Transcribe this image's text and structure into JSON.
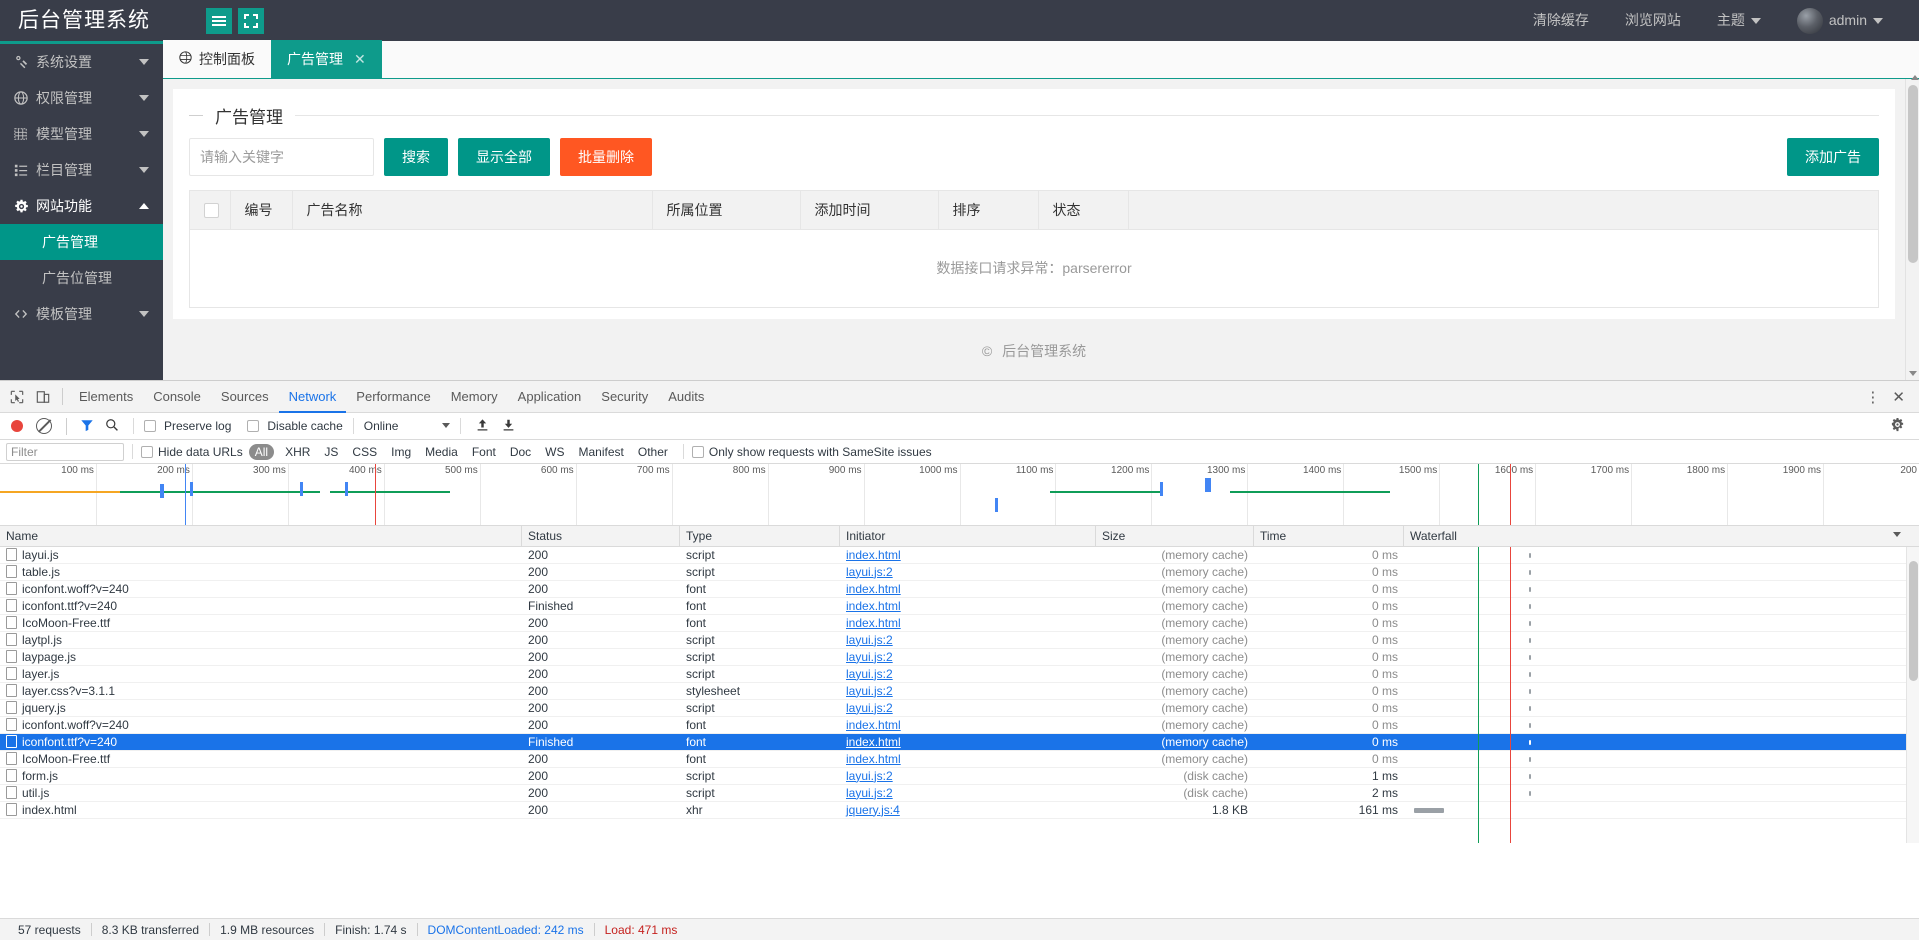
{
  "app": {
    "logo": "后台管理系统",
    "topnav": [
      {
        "label": "清除缓存",
        "caret": false
      },
      {
        "label": "浏览网站",
        "caret": false
      },
      {
        "label": "主题",
        "caret": true
      }
    ],
    "user": {
      "name": "admin",
      "caret": true
    },
    "sidebar": [
      {
        "label": "系统设置",
        "icon": "settings-icon",
        "state": "collapsed"
      },
      {
        "label": "权限管理",
        "icon": "globe-icon",
        "state": "collapsed"
      },
      {
        "label": "模型管理",
        "icon": "grid-icon",
        "state": "collapsed"
      },
      {
        "label": "栏目管理",
        "icon": "list-icon",
        "state": "collapsed"
      },
      {
        "label": "网站功能",
        "icon": "gear-icon",
        "state": "expanded"
      }
    ],
    "sidebar_sub": [
      {
        "label": "广告管理",
        "active": true
      },
      {
        "label": "广告位管理",
        "active": false
      },
      {
        "label": "模板管理",
        "active": false
      }
    ],
    "tabs": [
      {
        "label": "控制面板",
        "active": false,
        "closable": false,
        "icon": "globe-icon"
      },
      {
        "label": "广告管理",
        "active": true,
        "closable": true,
        "close": "✕"
      }
    ],
    "page": {
      "title": "广告管理",
      "search_placeholder": "请输入关键字",
      "search_value": "",
      "btn_search": "搜索",
      "btn_showall": "显示全部",
      "btn_batchdelete": "批量删除",
      "btn_add": "添加广告",
      "columns": [
        "编号",
        "广告名称",
        "所属位置",
        "添加时间",
        "排序",
        "状态",
        ""
      ],
      "empty_message": "数据接口请求异常：parsererror",
      "footer_copy": "©",
      "footer_text": "后台管理系统"
    },
    "colors": {
      "brand_teal": "#009688",
      "header_teal": "#0E9B8B",
      "dark": "#393D49",
      "orange": "#FF5722"
    }
  },
  "devtools": {
    "tabs": [
      "Elements",
      "Console",
      "Sources",
      "Network",
      "Performance",
      "Memory",
      "Application",
      "Security",
      "Audits"
    ],
    "active_tab": "Network",
    "kebab": "⋮",
    "close": "✕",
    "toolbar": {
      "preserve_log": "Preserve log",
      "disable_cache": "Disable cache",
      "throttle": "Online"
    },
    "filterbar": {
      "filter_placeholder": "Filter",
      "filter_value": "",
      "hide_data_urls": "Hide data URLs",
      "types": [
        "All",
        "XHR",
        "JS",
        "CSS",
        "Img",
        "Media",
        "Font",
        "Doc",
        "WS",
        "Manifest",
        "Other"
      ],
      "samesite": "Only show requests with SameSite issues"
    },
    "timeline_ticks": [
      "100 ms",
      "200 ms",
      "300 ms",
      "400 ms",
      "500 ms",
      "600 ms",
      "700 ms",
      "800 ms",
      "900 ms",
      "1000 ms",
      "1100 ms",
      "1200 ms",
      "1300 ms",
      "1400 ms",
      "1500 ms",
      "1600 ms",
      "1700 ms",
      "1800 ms",
      "1900 ms",
      "200"
    ],
    "columns": [
      "Name",
      "Status",
      "Type",
      "Initiator",
      "Size",
      "Time",
      "Waterfall"
    ],
    "rows": [
      {
        "name": "layui.js",
        "status": "200",
        "type": "script",
        "initiator": "index.html",
        "size": "(memory cache)",
        "time": "0 ms",
        "selected": false
      },
      {
        "name": "table.js",
        "status": "200",
        "type": "script",
        "initiator": "layui.js:2",
        "size": "(memory cache)",
        "time": "0 ms",
        "selected": false
      },
      {
        "name": "iconfont.woff?v=240",
        "status": "200",
        "type": "font",
        "initiator": "index.html",
        "size": "(memory cache)",
        "time": "0 ms",
        "selected": false
      },
      {
        "name": "iconfont.ttf?v=240",
        "status": "Finished",
        "type": "font",
        "initiator": "index.html",
        "size": "(memory cache)",
        "time": "0 ms",
        "selected": false
      },
      {
        "name": "IcoMoon-Free.ttf",
        "status": "200",
        "type": "font",
        "initiator": "index.html",
        "size": "(memory cache)",
        "time": "0 ms",
        "selected": false
      },
      {
        "name": "laytpl.js",
        "status": "200",
        "type": "script",
        "initiator": "layui.js:2",
        "size": "(memory cache)",
        "time": "0 ms",
        "selected": false
      },
      {
        "name": "laypage.js",
        "status": "200",
        "type": "script",
        "initiator": "layui.js:2",
        "size": "(memory cache)",
        "time": "0 ms",
        "selected": false
      },
      {
        "name": "layer.js",
        "status": "200",
        "type": "script",
        "initiator": "layui.js:2",
        "size": "(memory cache)",
        "time": "0 ms",
        "selected": false
      },
      {
        "name": "layer.css?v=3.1.1",
        "status": "200",
        "type": "stylesheet",
        "initiator": "layui.js:2",
        "size": "(memory cache)",
        "time": "0 ms",
        "selected": false
      },
      {
        "name": "jquery.js",
        "status": "200",
        "type": "script",
        "initiator": "layui.js:2",
        "size": "(memory cache)",
        "time": "0 ms",
        "selected": false
      },
      {
        "name": "iconfont.woff?v=240",
        "status": "200",
        "type": "font",
        "initiator": "index.html",
        "size": "(memory cache)",
        "time": "0 ms",
        "selected": false
      },
      {
        "name": "iconfont.ttf?v=240",
        "status": "Finished",
        "type": "font",
        "initiator": "index.html",
        "size": "(memory cache)",
        "time": "0 ms",
        "selected": true
      },
      {
        "name": "IcoMoon-Free.ttf",
        "status": "200",
        "type": "font",
        "initiator": "index.html",
        "size": "(memory cache)",
        "time": "0 ms",
        "selected": false
      },
      {
        "name": "form.js",
        "status": "200",
        "type": "script",
        "initiator": "layui.js:2",
        "size": "(disk cache)",
        "time": "1 ms",
        "selected": false
      },
      {
        "name": "util.js",
        "status": "200",
        "type": "script",
        "initiator": "layui.js:2",
        "size": "(disk cache)",
        "time": "2 ms",
        "selected": false
      },
      {
        "name": "index.html",
        "status": "200",
        "type": "xhr",
        "initiator": "jquery.js:4",
        "size": "1.8 KB",
        "time": "161 ms",
        "selected": false
      }
    ],
    "status": {
      "requests": "57 requests",
      "transferred": "8.3 KB transferred",
      "resources": "1.9 MB resources",
      "finish": "Finish: 1.74 s",
      "dcl": "DOMContentLoaded: 242 ms",
      "load": "Load: 471 ms"
    }
  }
}
